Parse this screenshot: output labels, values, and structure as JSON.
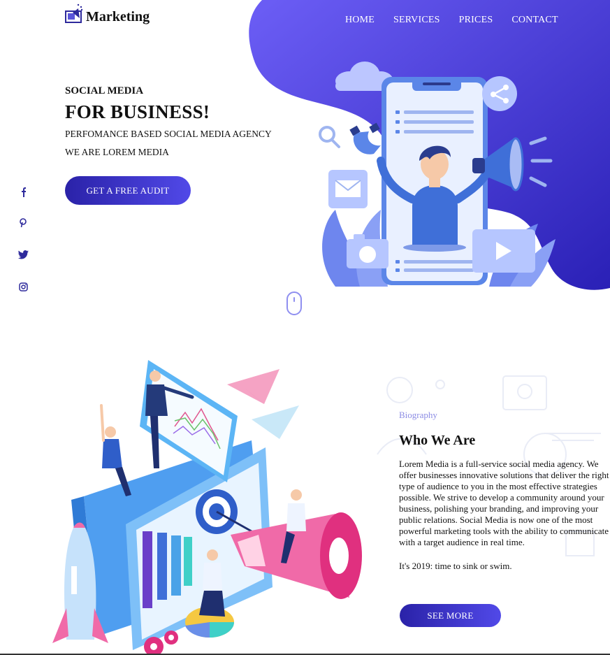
{
  "header": {
    "logo_text": "Marketing",
    "nav": [
      "HOME",
      "SERVICES",
      "PRICES",
      "CONTACT"
    ]
  },
  "hero": {
    "eyebrow": "SOCIAL MEDIA",
    "headline": "FOR BUSINESS!",
    "subtitle": "PERFOMANCE BASED SOCIAL MEDIA AGENCY",
    "tagline": "WE ARE LOREM MEDIA",
    "cta": "GET A FREE AUDIT"
  },
  "social": [
    {
      "icon": "facebook-icon",
      "glyph": "f"
    },
    {
      "icon": "pinterest-icon",
      "glyph": "P"
    },
    {
      "icon": "twitter-icon",
      "glyph": "t"
    },
    {
      "icon": "instagram-icon",
      "glyph": "o"
    }
  ],
  "about": {
    "eyebrow": "Biography",
    "title": "Who We Are",
    "paragraph": "Lorem Media is a full-service social media agency. We offer businesses innovative solutions that deliver the right type of audience to you in the most effective strategies possible. We strive to develop a community around your business, polishing your branding, and improving your public relations. Social Media is now one of the most powerful marketing tools with the ability to communicate with a target audience in real time.",
    "paragraph2": "It's 2019: time to sink or swim.",
    "button": "SEE MORE"
  },
  "colors": {
    "accent": "#4f46e5",
    "accent_dark": "#2a22a8",
    "blob_start": "#6a5cf5",
    "blob_end": "#2d23b8",
    "muted_label": "#8c8ce4"
  }
}
